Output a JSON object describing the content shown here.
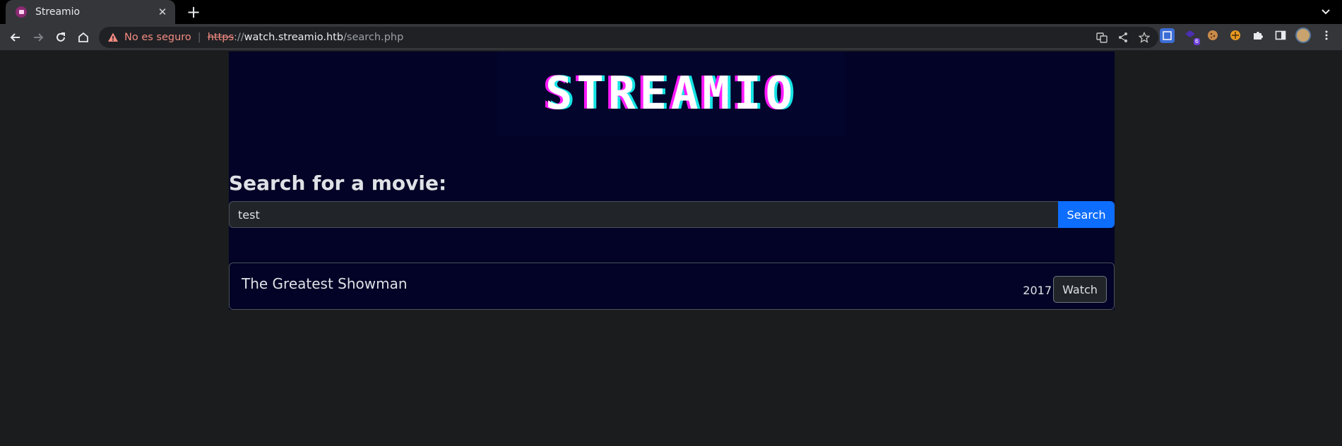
{
  "browser": {
    "tab": {
      "title": "Streamio",
      "close": "✕"
    },
    "newtab": "+",
    "omnibox": {
      "security_label": "No es seguro",
      "separator": "|",
      "scheme": "https",
      "scheme_sep": "://",
      "host": "watch.streamio.htb",
      "path": "/search.php"
    },
    "extension_badge": "6"
  },
  "page": {
    "logo": "STREAMIO",
    "search_heading": "Search for a movie:",
    "search": {
      "value": "test",
      "button_label": "Search"
    },
    "results": [
      {
        "title": "The Greatest Showman",
        "year": "2017",
        "action": "Watch"
      }
    ]
  },
  "colors": {
    "page_bg": "#020326",
    "accent": "#0d6efd",
    "logo_magenta": "#ff1aff",
    "logo_cyan": "#16e4e4",
    "warning": "#f28b82"
  }
}
